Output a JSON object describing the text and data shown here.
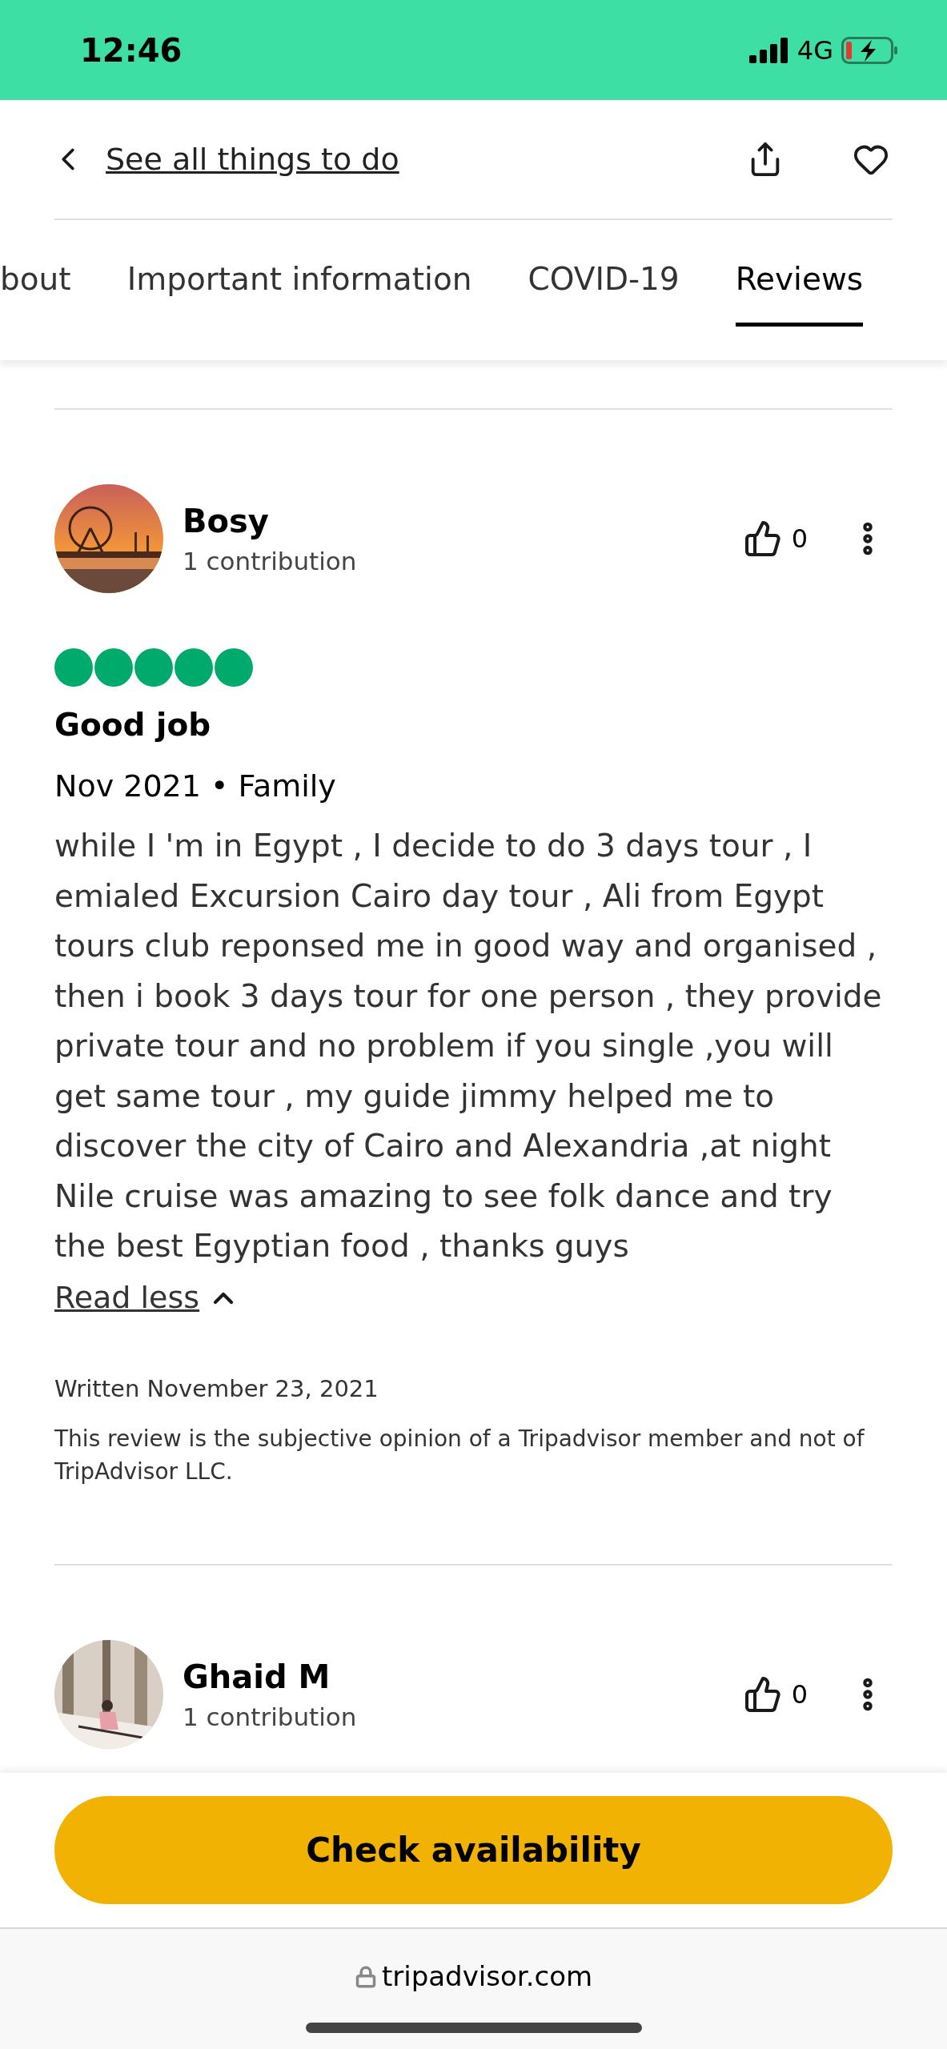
{
  "status_bar": {
    "time": "12:46",
    "network": "4G"
  },
  "header": {
    "back_link": "See all things to do"
  },
  "tabs": [
    {
      "label": "bout",
      "selected": false
    },
    {
      "label": "Important information",
      "selected": false
    },
    {
      "label": "COVID-19",
      "selected": false
    },
    {
      "label": "Reviews",
      "selected": true
    }
  ],
  "reviews": [
    {
      "author": "Bosy",
      "contributions": "1 contribution",
      "likes": "0",
      "stars": 5,
      "title": "Good job",
      "meta": "Nov 2021 • Family",
      "body": "while I 'm in Egypt , I decide to do 3 days tour , I emialed Excursion Cairo day tour , Ali from Egypt tours club reponsed me in good way and organised , then i book 3 days tour for one person , they provide private tour and no problem if you single ,you will get same tour , my guide jimmy helped me to discover the city of Cairo and Alexandria ,at night Nile cruise was amazing to see folk dance and try the best Egyptian food , thanks guys",
      "toggle": "Read less",
      "written": "Written November 23, 2021",
      "disclaimer": "This review is the subjective opinion of a Tripadvisor member and not of TripAdvisor LLC."
    },
    {
      "author": "Ghaid M",
      "contributions": "1 contribution",
      "likes": "0"
    }
  ],
  "cta": {
    "label": "Check availability"
  },
  "browser": {
    "url": "tripadvisor.com"
  }
}
